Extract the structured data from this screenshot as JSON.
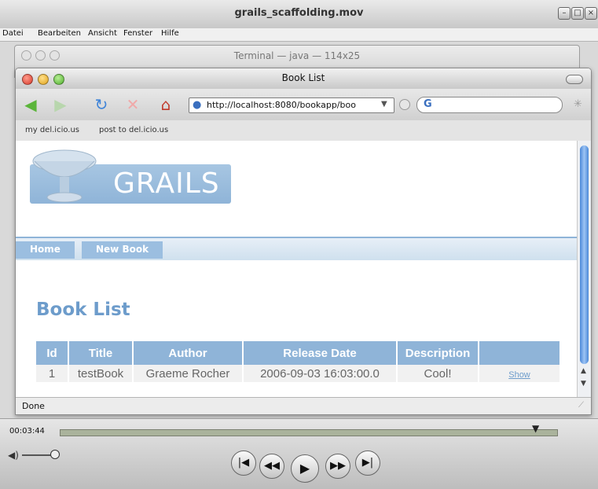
{
  "quicktime": {
    "title": "grails_scaffolding.mov",
    "menu": [
      "Datei",
      "Bearbeiten",
      "Ansicht",
      "Fenster",
      "Hilfe"
    ],
    "timecode": "00:03:44",
    "progress_fraction": 0.96
  },
  "terminal": {
    "title": "Terminal — java — 114x25"
  },
  "browser": {
    "title": "Book List",
    "url": "http://localhost:8080/bookapp/boo",
    "bookmarks": [
      "my del.icio.us",
      "post to del.icio.us"
    ],
    "status": "Done"
  },
  "page": {
    "logo_text": "GRAILS",
    "nav": [
      "Home",
      "New Book"
    ],
    "heading": "Book List",
    "table": {
      "columns": [
        "Id",
        "Title",
        "Author",
        "Release Date",
        "Description",
        ""
      ],
      "rows": [
        {
          "id": "1",
          "title": "testBook",
          "author": "Graeme Rocher",
          "release_date": "2006-09-03 16:03:00.0",
          "description": "Cool!",
          "action": "Show"
        }
      ]
    }
  },
  "colors": {
    "accent": "#8fb4d8",
    "heading": "#6d9ccb"
  }
}
